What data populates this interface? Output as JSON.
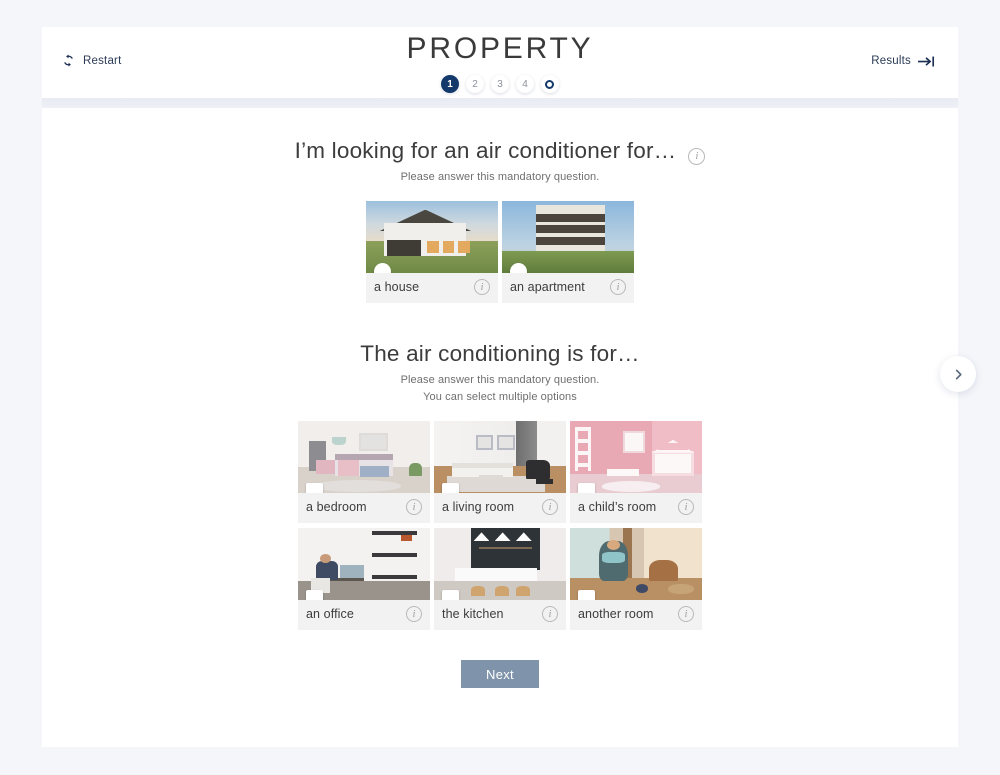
{
  "header": {
    "brand_title": "PROPERTY",
    "restart_label": "Restart",
    "restart_icon": "refresh-icon",
    "results_label": "Results",
    "results_icon": "arrow-to-line-icon",
    "steps": [
      {
        "label": "1",
        "state": "active"
      },
      {
        "label": "2",
        "state": "inactive"
      },
      {
        "label": "3",
        "state": "inactive"
      },
      {
        "label": "4",
        "state": "inactive"
      },
      {
        "label": "",
        "state": "finish",
        "icon": "ring-finish-icon"
      }
    ]
  },
  "questions": [
    {
      "title": "I’m looking for an air conditioner for…",
      "info_icon": "info-icon",
      "subtitle": "Please answer this mandatory question.",
      "subtitle2": "",
      "select_mode": "single",
      "options": [
        {
          "label": "a house",
          "selector": "radio",
          "checked": false,
          "info_icon": "info-icon",
          "scene": "house"
        },
        {
          "label": "an apartment",
          "selector": "radio",
          "checked": false,
          "info_icon": "info-icon",
          "scene": "apartment"
        }
      ]
    },
    {
      "title": "The air conditioning is for…",
      "info_icon": "",
      "subtitle": "Please answer this mandatory question.",
      "subtitle2": "You can select multiple options",
      "select_mode": "multiple",
      "options": [
        {
          "label": "a bedroom",
          "selector": "checkbox",
          "checked": false,
          "info_icon": "info-icon",
          "scene": "bedroom"
        },
        {
          "label": "a living room",
          "selector": "checkbox",
          "checked": false,
          "info_icon": "info-icon",
          "scene": "livingroom"
        },
        {
          "label": "a child’s room",
          "selector": "checkbox",
          "checked": false,
          "info_icon": "info-icon",
          "scene": "childroom"
        },
        {
          "label": "an office",
          "selector": "checkbox",
          "checked": false,
          "info_icon": "info-icon",
          "scene": "office"
        },
        {
          "label": "the kitchen",
          "selector": "checkbox",
          "checked": false,
          "info_icon": "info-icon",
          "scene": "kitchen"
        },
        {
          "label": "another room",
          "selector": "checkbox",
          "checked": false,
          "info_icon": "info-icon",
          "scene": "gym"
        }
      ]
    }
  ],
  "footer": {
    "next_label": "Next"
  },
  "side_nav": {
    "next_icon": "chevron-right-icon"
  },
  "colors": {
    "page_background": "#f4f6fa",
    "card_background": "#ffffff",
    "accent_navy": "#143a6b",
    "next_button": "#7f93aa",
    "option_tile": "#f2f2f2",
    "title_text": "#3c3c3c",
    "subtitle_text": "#6f6f6f"
  },
  "info_glyph": "i"
}
